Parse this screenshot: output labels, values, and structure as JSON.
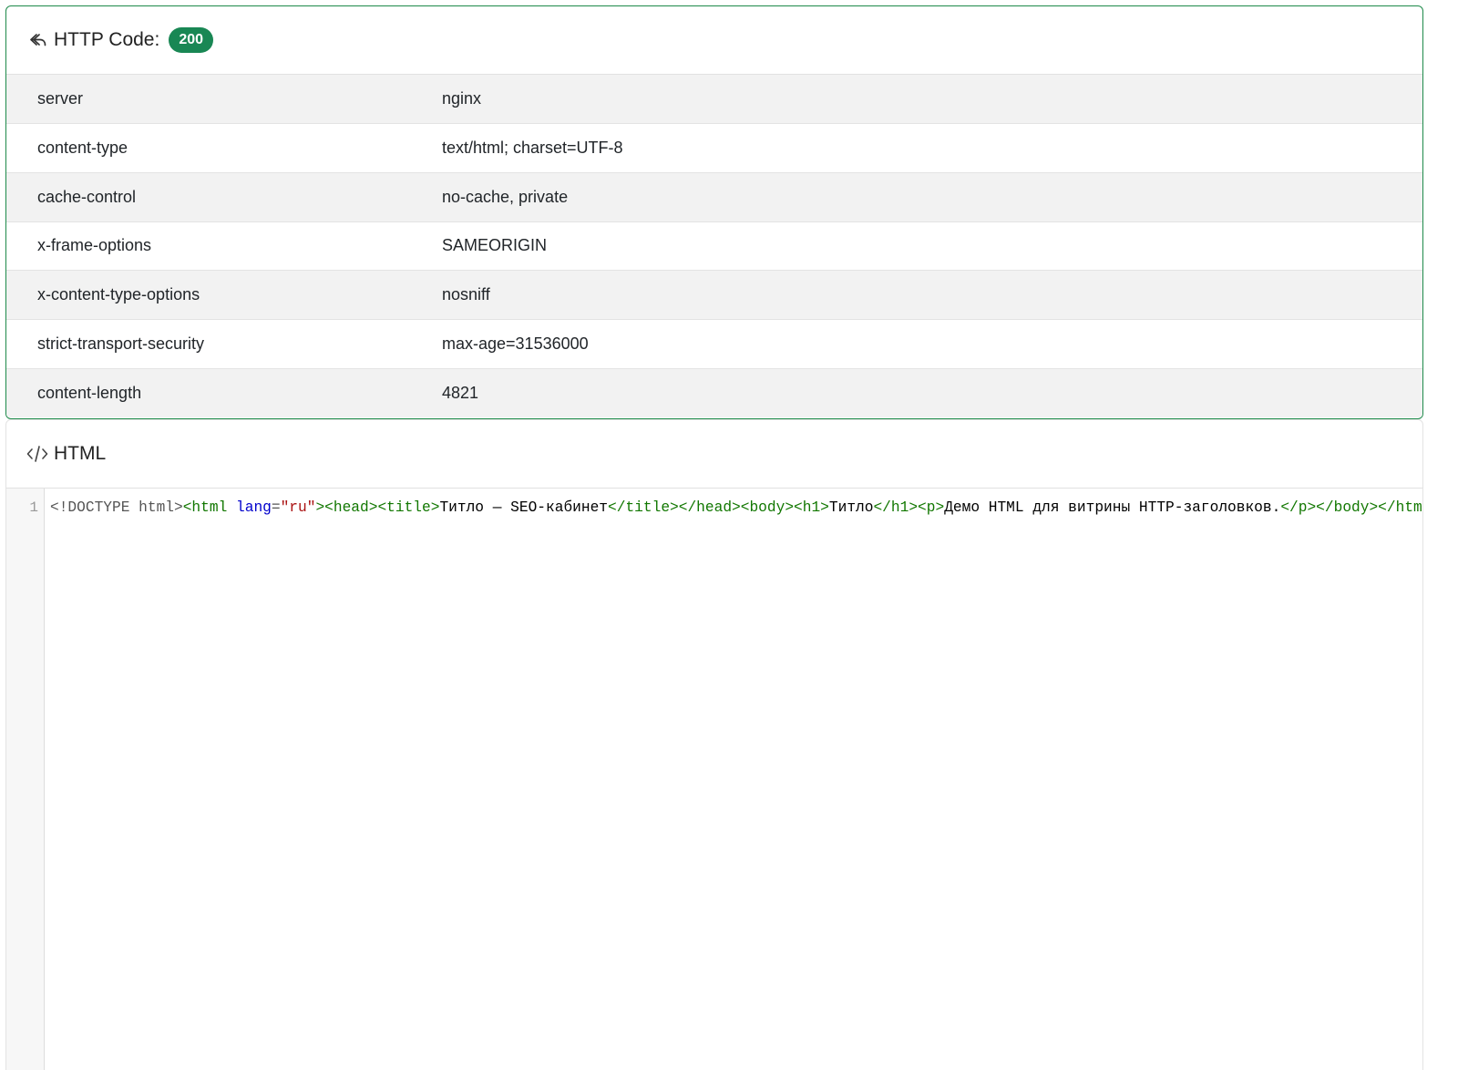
{
  "http_panel": {
    "title": "HTTP Code:",
    "status_code": "200",
    "icon": "reply-arrow-icon",
    "headers": [
      {
        "key": "server",
        "value": "nginx"
      },
      {
        "key": "content-type",
        "value": "text/html; charset=UTF-8"
      },
      {
        "key": "cache-control",
        "value": "no-cache, private"
      },
      {
        "key": "x-frame-options",
        "value": "SAMEORIGIN"
      },
      {
        "key": "x-content-type-options",
        "value": "nosniff"
      },
      {
        "key": "strict-transport-security",
        "value": "max-age=31536000"
      },
      {
        "key": "content-length",
        "value": "4821"
      }
    ]
  },
  "html_panel": {
    "title": "HTML",
    "icon": "code-icon",
    "line_number": "1",
    "code_tokens": [
      {
        "type": "meta",
        "text": "<!DOCTYPE html>"
      },
      {
        "type": "tag",
        "text": "<html "
      },
      {
        "type": "attr",
        "text": "lang"
      },
      {
        "type": "meta",
        "text": "="
      },
      {
        "type": "str",
        "text": "\"ru\""
      },
      {
        "type": "tag",
        "text": "><head><title>"
      },
      {
        "type": "text",
        "text": "Титло — SEO-кабинет"
      },
      {
        "type": "tag",
        "text": "</title></head><body><h1>"
      },
      {
        "type": "text",
        "text": "Титло"
      },
      {
        "type": "tag",
        "text": "</h1><p>"
      },
      {
        "type": "text",
        "text": "Демо HTML для витрины HTTP-заголовков."
      },
      {
        "type": "tag",
        "text": "</p></body></html>"
      }
    ]
  },
  "colors": {
    "accent_green": "#198754",
    "panel_border_green": "#1e8a4a",
    "row_stripe": "#f2f2f2",
    "code_tag": "#117700",
    "code_attr": "#0000cc",
    "code_string": "#aa1111",
    "code_meta": "#555555"
  }
}
